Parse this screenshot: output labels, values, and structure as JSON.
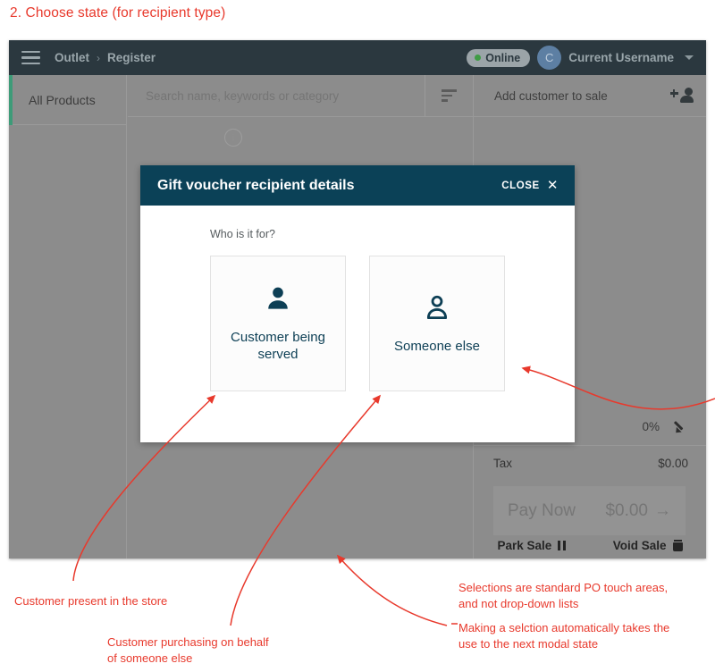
{
  "annotation": {
    "step_title": "2. Choose state (for recipient type)",
    "accent_color": "#e8392c",
    "notes": [
      {
        "id": "customer-present",
        "text": "Customer present in the store"
      },
      {
        "id": "on-behalf",
        "text": "Customer purchasing on behalf\nof someone else"
      },
      {
        "id": "touch-areas",
        "text": "Selections are standard PO touch areas,\nand not drop-down lists"
      },
      {
        "id": "auto-advance",
        "text": "Making a selction automatically takes the\nuse to the next modal state"
      }
    ]
  },
  "app": {
    "topbar": {
      "menu_icon": "hamburger-icon",
      "breadcrumb": {
        "root": "Outlet",
        "separator": "›",
        "current": "Register"
      },
      "status_badge": {
        "label": "Online",
        "dot_color": "#3f9c45"
      },
      "avatar_initial": "C",
      "username": "Current Username",
      "caret_icon": "chevron-down-icon"
    },
    "left_panel": {
      "all_products_label": "All Products"
    },
    "search": {
      "placeholder": "Search name, keywords or category",
      "value": "",
      "filter_icon": "filter-sort-icon",
      "info_icon": "info-circle-icon"
    },
    "cart_panel": {
      "add_customer_label": "Add customer to sale",
      "add_customer_icon": "add-person-icon",
      "discount_value": "0%",
      "edit_icon": "pencil-icon",
      "tax_label": "Tax",
      "tax_value": "$0.00",
      "pay_now_label": "Pay Now",
      "pay_now_amount": "$0.00",
      "pay_now_arrow": "→",
      "park_sale_label": "Park Sale",
      "park_sale_icon": "pause-icon",
      "void_sale_label": "Void Sale",
      "void_sale_icon": "trash-icon"
    }
  },
  "modal": {
    "title": "Gift voucher recipient details",
    "close_label": "CLOSE",
    "close_icon": "close-x-icon",
    "header_color": "#0b4157",
    "question": "Who is it for?",
    "choices": [
      {
        "id": "customer-being-served",
        "label": "Customer\nbeing served",
        "icon": "person-filled-icon"
      },
      {
        "id": "someone-else",
        "label": "Someone else",
        "icon": "person-outline-icon"
      }
    ]
  }
}
